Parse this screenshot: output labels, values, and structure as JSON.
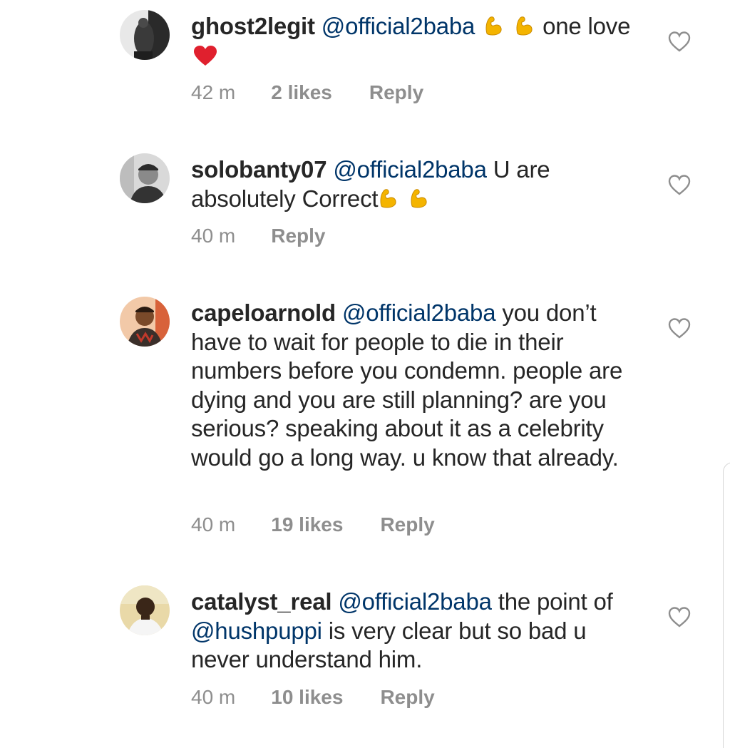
{
  "comments": [
    {
      "username": "ghost2legit",
      "mention": "@official2baba",
      "text_before": "",
      "emojis_after_mention": [
        "flexed-biceps",
        "flexed-biceps"
      ],
      "text": "one love",
      "trailing_emoji": "red-heart",
      "time": "42 m",
      "likes": "2 likes",
      "reply": "Reply",
      "liked": false
    },
    {
      "username": "solobanty07",
      "mention": "@official2baba",
      "text": "U are absolutely Correct",
      "trailing_emojis": [
        "flexed-biceps",
        "flexed-biceps"
      ],
      "time": "40 m",
      "likes": "",
      "reply": "Reply",
      "liked": false
    },
    {
      "username": "capeloarnold",
      "mention": "@official2baba",
      "text": "you don’t have to wait for people to die in their numbers before you condemn. people are dying and you are still planning? are you serious? speaking about it as a celebrity would go a long way. u know that already.",
      "time": "40 m",
      "likes": "19 likes",
      "reply": "Reply",
      "liked": false
    },
    {
      "username": "catalyst_real",
      "mention": "@official2baba",
      "text": "the point of",
      "mention2": "@hushpuppi",
      "text2": "is very clear but so bad u never understand him.",
      "time": "40 m",
      "likes": "10 likes",
      "reply": "Reply",
      "liked": false
    }
  ],
  "colors": {
    "username": "#262626",
    "mention": "#003569",
    "meta": "#8e8e8e",
    "heart_outline": "#8e8e8e",
    "emoji_heart": "#e0202e",
    "emoji_bicep": "#f4b400"
  }
}
